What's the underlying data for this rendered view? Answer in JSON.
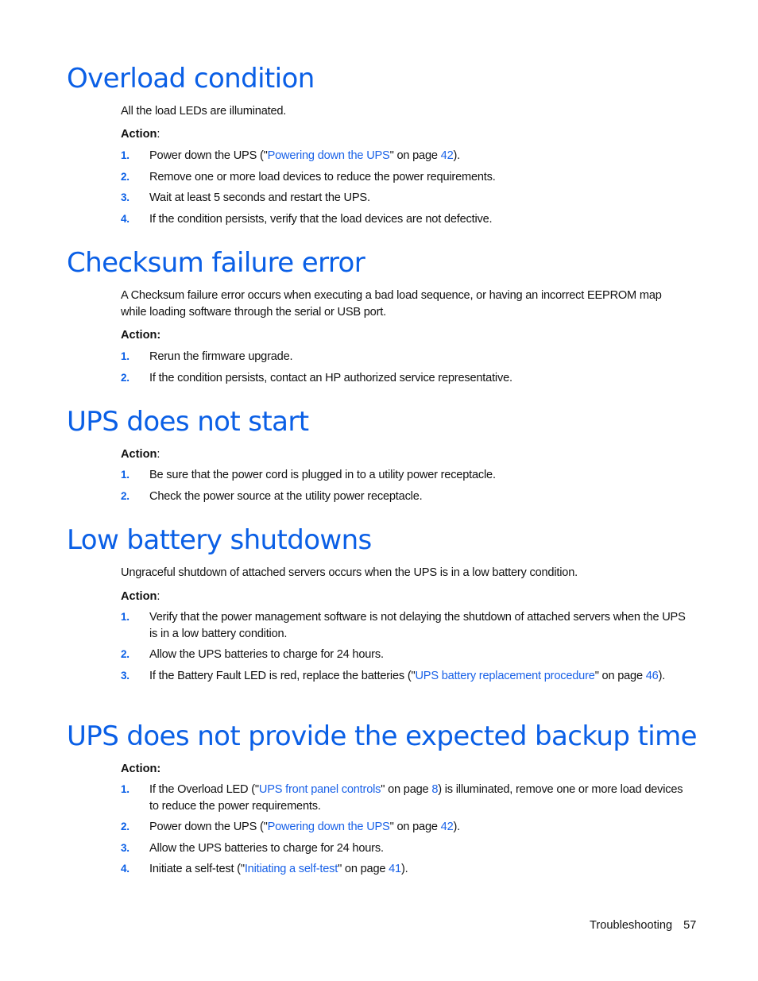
{
  "colors": {
    "heading": "#0a5fe6",
    "link": "#1a62e8",
    "text": "#111111"
  },
  "sections": [
    {
      "title": "Overload condition",
      "body": "All the load LEDs are illuminated.",
      "action_label": "Action",
      "action_colon": ":",
      "steps": [
        {
          "num": "1.",
          "pre": "Power down the UPS (\"",
          "link": "Powering down the UPS",
          "mid": "\" on page ",
          "page": "42",
          "post": ")."
        },
        {
          "num": "2.",
          "pre": "Remove one or more load devices to reduce the power requirements."
        },
        {
          "num": "3.",
          "pre": "Wait at least 5 seconds and restart the UPS."
        },
        {
          "num": "4.",
          "pre": "If the condition persists, verify that the load devices are not defective."
        }
      ]
    },
    {
      "title": "Checksum failure error",
      "body": "A Checksum failure error occurs when executing a bad load sequence, or having an incorrect EEPROM map while loading software through the serial or USB port.",
      "action_label": "Action:",
      "action_colon": "",
      "steps": [
        {
          "num": "1.",
          "pre": "Rerun the firmware upgrade."
        },
        {
          "num": "2.",
          "pre": "If the condition persists, contact an HP authorized service representative."
        }
      ]
    },
    {
      "title": "UPS does not start",
      "action_label": "Action",
      "action_colon": ":",
      "steps": [
        {
          "num": "1.",
          "pre": "Be sure that the power cord is plugged in to a utility power receptacle."
        },
        {
          "num": "2.",
          "pre": "Check the power source at the utility power receptacle."
        }
      ]
    },
    {
      "title": "Low battery shutdowns",
      "body": "Ungraceful shutdown of attached servers occurs when the UPS is in a low battery condition.",
      "action_label": "Action",
      "action_colon": ":",
      "steps": [
        {
          "num": "1.",
          "pre": "Verify that the power management software is not delaying the shutdown of attached servers when the UPS is in a low battery condition."
        },
        {
          "num": "2.",
          "pre": "Allow the UPS batteries to charge for 24 hours."
        },
        {
          "num": "3.",
          "pre": "If the Battery Fault LED is red, replace the batteries (\"",
          "link": "UPS battery replacement procedure",
          "mid": "\" on page ",
          "page": "46",
          "post": ")."
        }
      ]
    },
    {
      "title": "UPS does not provide the expected backup time",
      "action_label": "Action:",
      "action_colon": "",
      "steps": [
        {
          "num": "1.",
          "pre": "If the Overload LED (\"",
          "link": "UPS front panel controls",
          "mid": "\" on page ",
          "page": "8",
          "post": ") is illuminated, remove one or more load devices to reduce the power requirements."
        },
        {
          "num": "2.",
          "pre": "Power down the UPS (\"",
          "link": "Powering down the UPS",
          "mid": "\" on page ",
          "page": "42",
          "post": ")."
        },
        {
          "num": "3.",
          "pre": "Allow the UPS batteries to charge for 24 hours."
        },
        {
          "num": "4.",
          "pre": "Initiate a self-test (\"",
          "link": "Initiating a self-test",
          "mid": "\" on page ",
          "page": "41",
          "post": ")."
        }
      ]
    }
  ],
  "footer": {
    "section": "Troubleshooting",
    "page": "57"
  }
}
